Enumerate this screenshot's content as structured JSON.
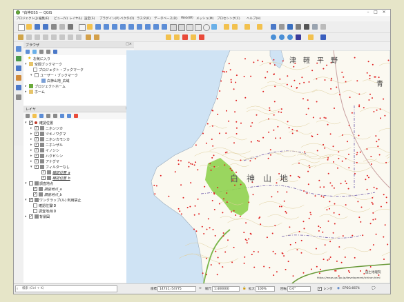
{
  "window": {
    "title": "*白神OSS — QGIS"
  },
  "menubar": [
    "プロジェクト(J)",
    "編集(E)",
    "ビュー(V)",
    "レイヤ(L)",
    "設定(S)",
    "プラグイン(P)",
    "ベクタ(O)",
    "ラスタ(R)",
    "データベース(D)",
    "Web(W)",
    "メッシュ(M)",
    "プロセシング(C)",
    "ヘルプ(H)"
  ],
  "browser_panel": {
    "title": "ブラウザ",
    "items": [
      "お気に入り",
      "空間ブックマーク",
      "プロジェクト・ブックマーク",
      "ユーザー・ブックマーク",
      "白神山地_広域",
      "プロジェクトホーム",
      "ホーム"
    ]
  },
  "layers_panel": {
    "title": "レイヤ",
    "items": [
      "確認位置",
      "ニホンジカ",
      "ツキノワグマ",
      "ニホンカモシカ",
      "ニホンザル",
      "イノシシ",
      "ハクビシン",
      "アナグマ",
      "フィルターなし",
      "確認位置_a",
      "確認位置_b",
      "調査地点",
      "調査地点_a",
      "調査地点_b",
      "ワンクラップ(ル) 利用禁止",
      "確認位置ID",
      "調査地点ID",
      "背景図"
    ]
  },
  "map": {
    "labels": {
      "tsugaru": "津　軽　平　野",
      "shirakami": "白　神　山　地",
      "ao": "青"
    },
    "attribution": "国土地理院",
    "attribution_url": "https://maps.gsi.go.jp/development/ichiran.html"
  },
  "statusbar": {
    "search_placeholder": "検索 (Ctrl + K)",
    "coord_label": "座標",
    "coord_value": "14731,-54775",
    "scale_label": "縮尺",
    "scale_value": "1:400000",
    "magnifier_label": "拡大",
    "magnifier_value": "100%",
    "rotation_label": "回転",
    "rotation_value": "0.0°",
    "render_label": "レンダ",
    "crs_label": "EPSG:6674"
  },
  "colors": {
    "sea": "#cfe3f4",
    "land": "#fbf9f1",
    "contour": "#e0cf9e",
    "points": "#e02020",
    "protected": "#8fd14f",
    "boundary": "#6a55a8"
  }
}
